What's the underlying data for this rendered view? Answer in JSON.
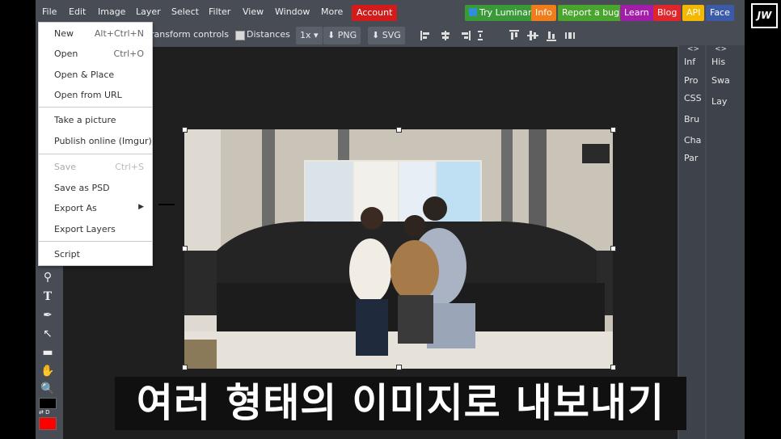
{
  "menubar": {
    "items": [
      "File",
      "Edit",
      "Image",
      "Layer",
      "Select",
      "Filter",
      "View",
      "Window",
      "More"
    ],
    "account": "Account",
    "right_buttons": [
      {
        "label": "Try Luminar",
        "color": "#3a9a3a"
      },
      {
        "label": "Info",
        "color": "#f07d1a"
      },
      {
        "label": "Report a bug",
        "color": "#4aa52e"
      },
      {
        "label": "Learn",
        "color": "#a21ea8"
      },
      {
        "label": "Blog",
        "color": "#e0262c"
      },
      {
        "label": "API",
        "color": "#f5b800"
      },
      {
        "label": "Face",
        "color": "#3b5aa8"
      }
    ]
  },
  "toolbar": {
    "transform_controls": "ransform controls",
    "distances": "Distances",
    "zoom": "1x",
    "png": "PNG",
    "svg": "SVG"
  },
  "file_menu": {
    "items": [
      {
        "label": "New",
        "shortcut": "Alt+Ctrl+N"
      },
      {
        "label": "Open",
        "shortcut": "Ctrl+O"
      },
      {
        "label": "Open & Place",
        "shortcut": ""
      },
      {
        "label": "Open from URL",
        "shortcut": ""
      },
      {
        "label": "Take a picture",
        "shortcut": ""
      },
      {
        "label": "Publish online (Imgur)",
        "shortcut": ""
      },
      {
        "label": "Save",
        "shortcut": "Ctrl+S"
      },
      {
        "label": "Save as PSD",
        "shortcut": ""
      },
      {
        "label": "Export As",
        "shortcut": "▶"
      },
      {
        "label": "Export Layers",
        "shortcut": ""
      },
      {
        "label": "Script",
        "shortcut": ""
      }
    ]
  },
  "right_panel_1": [
    "Inf",
    "Pro",
    "CSS",
    "Bru",
    "Cha",
    "Par"
  ],
  "right_panel_2": [
    "His",
    "Swa",
    "Lay"
  ],
  "panel_arrows": "<>",
  "colors": {
    "foreground": "#000000",
    "background": "#ff0000"
  },
  "color_swap_label": "⇄ D",
  "subtitle": "여러 형태의 이미지로 내보내기",
  "logo": "JW"
}
